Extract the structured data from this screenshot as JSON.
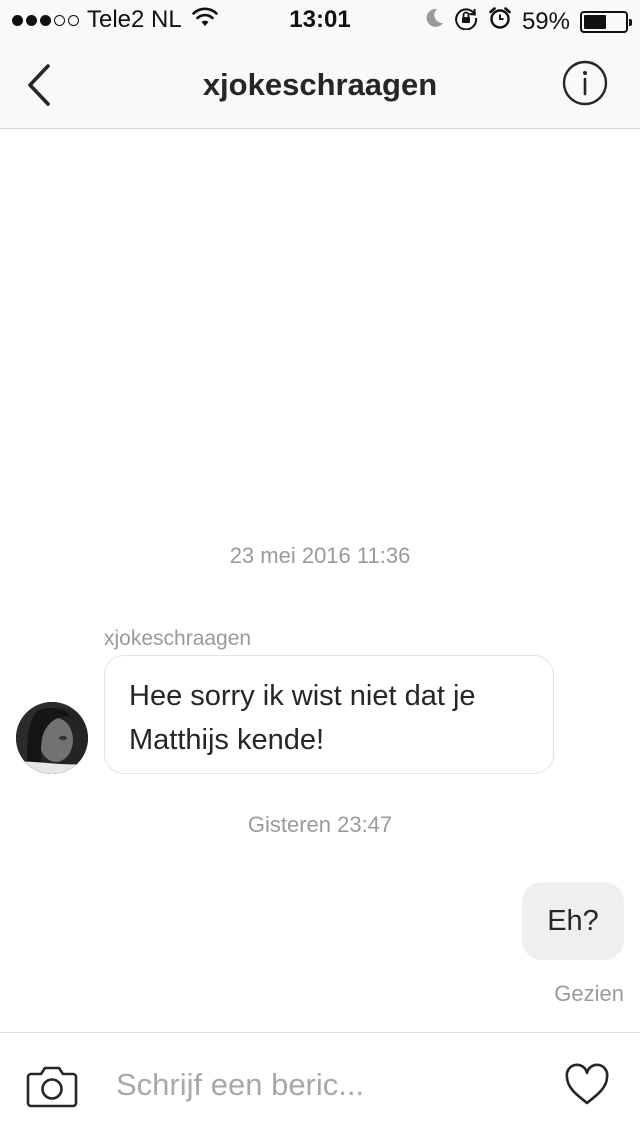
{
  "status_bar": {
    "signal_bars_filled": 3,
    "signal_bars_total": 5,
    "carrier": "Tele2 NL",
    "time": "13:01",
    "battery_percent": "59%",
    "battery_level": 0.59,
    "icons": [
      "wifi-icon",
      "moon-icon",
      "rotation-lock-icon",
      "alarm-icon"
    ]
  },
  "header": {
    "title": "xjokeschraagen",
    "back_icon": "chevron-left-icon",
    "info_icon": "info-icon"
  },
  "conversation": {
    "messages": [
      {
        "timestamp": "23 mei 2016 11:36",
        "sender": "xjokeschraagen",
        "direction": "incoming",
        "lines": [
          "Hee sorry ik wist niet dat je",
          "Matthijs kende!"
        ]
      },
      {
        "timestamp": "Gisteren 23:47",
        "direction": "outgoing",
        "text": "Eh?",
        "status": "Gezien"
      }
    ]
  },
  "composer": {
    "camera_icon": "camera-icon",
    "placeholder": "Schrijf een beric...",
    "value": "",
    "heart_icon": "heart-icon"
  }
}
